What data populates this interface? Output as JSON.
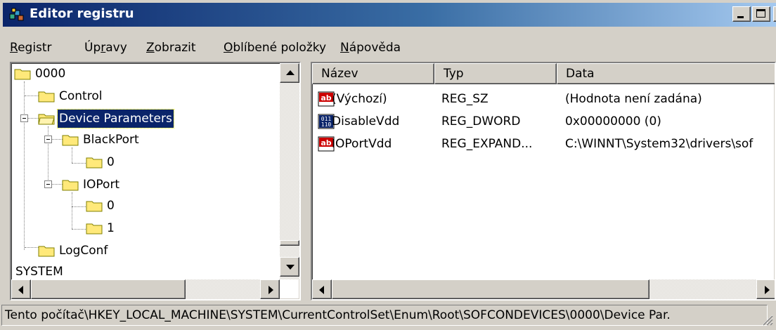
{
  "window": {
    "title": "Editor registru"
  },
  "menu": [
    {
      "label": "Registr",
      "u": "R",
      "rest": "egistr"
    },
    {
      "label": "Úpravy",
      "pre": "Úp",
      "u": "r",
      "rest": "avy"
    },
    {
      "label": "Zobrazit",
      "u": "Z",
      "rest": "obrazit"
    },
    {
      "label": "Oblíbené položky",
      "u": "O",
      "rest": "blíbené položky"
    },
    {
      "label": "Nápověda",
      "u": "N",
      "rest": "ápověda"
    }
  ],
  "tree": {
    "root": "0000",
    "items": [
      {
        "label": "Control"
      },
      {
        "label": "Device Parameters",
        "selected": true
      },
      {
        "label": "BlackPort"
      },
      {
        "label": "0"
      },
      {
        "label": "IOPort"
      },
      {
        "label": "0"
      },
      {
        "label": "1"
      },
      {
        "label": "LogConf"
      }
    ],
    "bottom_label": "SYSTEM"
  },
  "list": {
    "columns": [
      "Název",
      "Typ",
      "Data"
    ],
    "rows": [
      {
        "icon": "string-value-icon",
        "name": "(Výchozí)",
        "type": "REG_SZ",
        "data": "(Hodnota není zadána)"
      },
      {
        "icon": "binary-value-icon",
        "name": "DisableVdd",
        "type": "REG_DWORD",
        "data": "0x00000000 (0)"
      },
      {
        "icon": "string-value-icon",
        "name": "IOPortVdd",
        "type": "REG_EXPAND...",
        "data": "C:\\WINNT\\System32\\drivers\\sof"
      }
    ]
  },
  "status": {
    "path": "Tento počítač\\HKEY_LOCAL_MACHINE\\SYSTEM\\CurrentControlSet\\Enum\\Root\\SOFCONDEVICES\\0000\\Device Par."
  },
  "colors": {
    "title_start": "#0a246a",
    "title_end": "#a6caf0",
    "selection": "#0a246a",
    "chrome": "#d4d0c8",
    "folder": "#ffe97a"
  }
}
